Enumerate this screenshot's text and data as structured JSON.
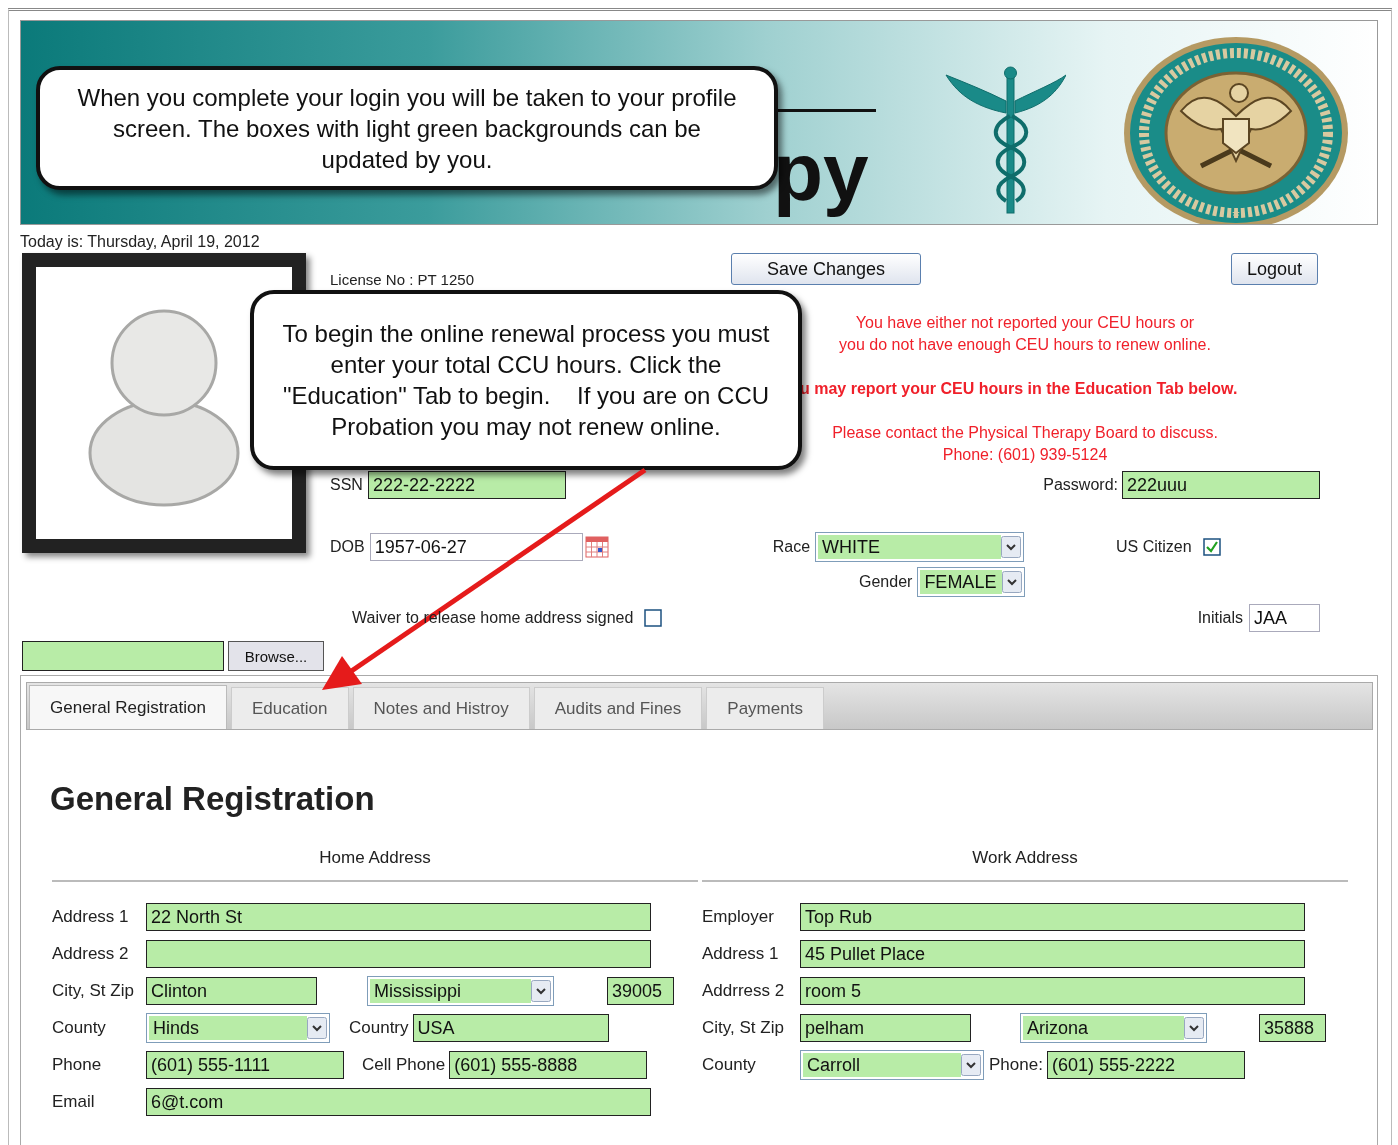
{
  "banner": {
    "title_bottom": "py"
  },
  "callouts": [
    {
      "text": "When you complete your login you will be taken to your profile screen. The boxes with light green backgrounds can be updated by you."
    },
    {
      "text": "To begin the online renewal process you must enter your total CCU hours. Click the \"Education\" Tab to begin.    If you are on CCU Probation you may not renew online."
    }
  ],
  "date_line": "Today is: Thursday, April 19, 2012",
  "profile": {
    "license": "License No : PT 1250",
    "save_button": "Save Changes",
    "logout_button": "Logout",
    "notice_lines": [
      "You have either not reported your CEU hours or",
      "you do not have enough CEU hours to renew online."
    ],
    "report_line": "u may report your CEU hours in the Education Tab below.",
    "contact_lines": [
      "Please contact the Physical Therapy Board to discuss.",
      "Phone: (601) 939-5124"
    ],
    "ssn": {
      "label": "SSN",
      "value": "222-22-2222",
      "editable": true
    },
    "password": {
      "label": "Password:",
      "value": "222uuu",
      "editable": true
    },
    "dob": {
      "label": "DOB",
      "value": "1957-06-27",
      "editable": false
    },
    "race": {
      "label": "Race",
      "value": "WHITE",
      "editable": true
    },
    "us_citizen": {
      "label": "US Citizen",
      "checked": true
    },
    "gender": {
      "label": "Gender",
      "value": "FEMALE",
      "editable": true
    },
    "waiver": {
      "label": "Waiver to release home address signed",
      "checked": false
    },
    "initials": {
      "label": "Initials",
      "value": "JAA",
      "editable": false
    },
    "upload": {
      "editable": true,
      "button": "Browse..."
    }
  },
  "tabs": [
    {
      "label": "General Registration",
      "selected": true
    },
    {
      "label": "Education",
      "selected": false
    },
    {
      "label": "Notes and Histroy",
      "selected": false
    },
    {
      "label": "Audits and Fines",
      "selected": false
    },
    {
      "label": "Payments",
      "selected": false
    }
  ],
  "section_title": "General Registration",
  "home_address": {
    "heading": "Home Address",
    "address_1": {
      "label": "Address 1",
      "value": "22 North St",
      "editable": true
    },
    "address_2": {
      "label": "Address 2",
      "editable": true
    },
    "city_state_zip": {
      "label": "City, St Zip",
      "city": {
        "value": "Clinton",
        "editable": true
      },
      "state": {
        "value": "Mississippi",
        "editable": true
      },
      "zip": {
        "value": "39005",
        "editable": true
      }
    },
    "county": {
      "label": "County",
      "value": "Hinds",
      "editable": true
    },
    "country": {
      "label": "Country",
      "value": "USA",
      "editable": true
    },
    "phone": {
      "label": "Phone",
      "value": "(601) 555-1111",
      "editable": true
    },
    "cell_phone": {
      "label": "Cell Phone",
      "value": "(601) 555-8888",
      "editable": true
    },
    "email": {
      "label": "Email",
      "value": "6@t.com",
      "editable": true
    }
  },
  "work_address": {
    "heading": "Work Address",
    "employer": {
      "label": "Employer",
      "value": "Top Rub",
      "editable": true
    },
    "address_1": {
      "label": "Address 1",
      "value": "45 Pullet Place",
      "editable": true
    },
    "address_2": {
      "label": "Addrress 2",
      "value": "room 5",
      "editable": true
    },
    "city_state_zip": {
      "label": "City, St Zip",
      "city": {
        "value": "pelham",
        "editable": true
      },
      "state": {
        "value": "Arizona",
        "editable": true
      },
      "zip": {
        "value": "35888",
        "editable": true
      }
    },
    "county": {
      "label": "County",
      "value": "Carroll",
      "editable": true
    },
    "phone": {
      "label": "Phone:",
      "value": "(601) 555-2222",
      "editable": true
    }
  }
}
